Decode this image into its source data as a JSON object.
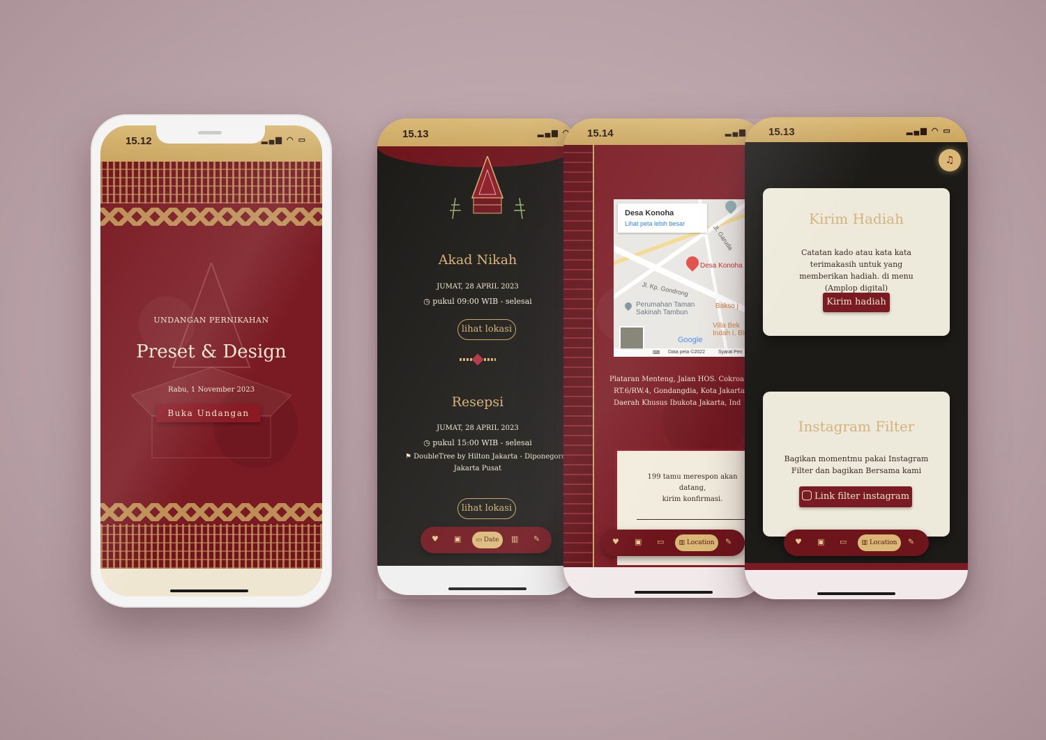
{
  "phone1": {
    "time": "15.12",
    "subtitle": "UNDANGAN PERNIKAHAN",
    "title": "Preset & Design",
    "date": "Rabu, 1 November 2023",
    "open_button": "Buka Undangan"
  },
  "phone2": {
    "time": "15.13",
    "akad": {
      "title": "Akad Nikah",
      "date": "JUMAT, 28 APRIL 2023",
      "time": "pukul 09:00 WIB - selesai",
      "button": "lihat lokasi"
    },
    "resepsi": {
      "title": "Resepsi",
      "date": "JUMAT, 28 APRIL 2023",
      "time": "pukul 15:00 WIB - selesai",
      "venue_line1": "DoubleTree by Hilton Jakarta - Diponegoro",
      "venue_line2": "Jakarta Pusat",
      "button": "lihat lokasi"
    },
    "nav_active": "Date"
  },
  "phone3": {
    "time": "15.14",
    "map": {
      "place": "Desa Konoha",
      "link": "Lihat peta lebih besar",
      "pin_label": "Desa Konoha",
      "road1": "Jl. Garuda",
      "road2": "Jl. Kp. Gondrong",
      "poi1_line1": "Perumahan Taman",
      "poi1_line2": "Sakinah Tambun",
      "poi2": "Bakso j",
      "poi3_line1": "Villa Bek",
      "poi3_line2": "Indah I, Blok",
      "google": "Google",
      "data": "Data peta ©2022",
      "terms": "Syarat Pen"
    },
    "address_line1": "Plataran Menteng, Jalan HOS. Cokroa",
    "address_line2": "RT.6/RW.4, Gondangdia, Kota Jakarta",
    "address_line3": "Daerah Khusus Ibukota Jakarta, Ind",
    "rsvp_line1": "199 tamu merespon akan",
    "rsvp_line2": "datang,",
    "rsvp_line3": "kirim konfirmasi.",
    "nav_active": "Location"
  },
  "phone4": {
    "time": "15.13",
    "gift": {
      "title": "Kirim Hadiah",
      "text": "Catatan kado atau kata kata terimakasih untuk yang memberikan hadiah. di menu (Amplop digital)",
      "button": "Kirim hadiah"
    },
    "filter": {
      "title": "Instagram Filter",
      "text": "Bagikan momentmu pakai Instagram Filter dan bagikan Bersama kami",
      "button": "Link filter instagram"
    },
    "nav_active": "Location"
  },
  "colors": {
    "maroon": "#7a1a22",
    "gold": "#d6b071",
    "dark": "#1c1a17",
    "cream": "#eeeadb"
  }
}
